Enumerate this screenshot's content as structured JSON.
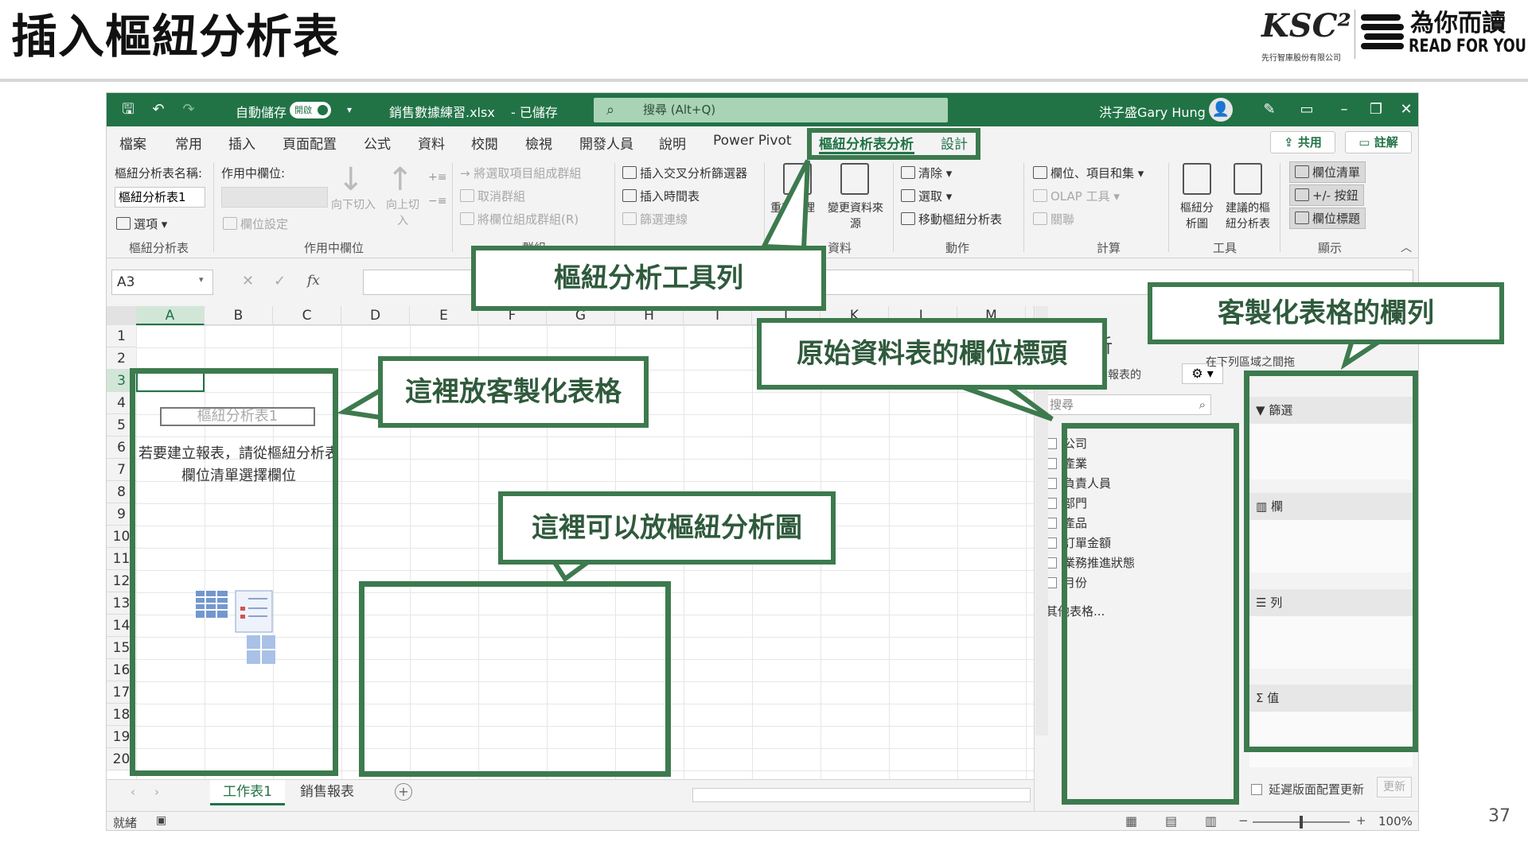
{
  "slide": {
    "title": "插入樞紐分析表",
    "page_number": "37",
    "logo_ksc": "KSC²",
    "logo_ksc_sub": "先行智庫股份有限公司",
    "logo_rfy_cn": "為你而讀",
    "logo_rfy_en": "READ FOR YOU"
  },
  "excel": {
    "titlebar": {
      "autosave_label": "自動儲存",
      "autosave_toggle": "開啟",
      "filename": "銷售數據練習.xlsx",
      "saved_state": "- 已儲存",
      "search_placeholder": "搜尋 (Alt+Q)",
      "user_name": "洪子盛Gary Hung"
    },
    "tabs": [
      "檔案",
      "常用",
      "插入",
      "頁面配置",
      "公式",
      "資料",
      "校閱",
      "檢視",
      "開發人員",
      "說明",
      "Power Pivot",
      "樞紐分析表分析",
      "設計"
    ],
    "share_button": "共用",
    "comment_button": "註解",
    "ribbon": {
      "pivot_name_label": "樞紐分析表名稱:",
      "pivot_name_value": "樞紐分析表1",
      "options_button": "選項",
      "group_pivot": "樞紐分析表",
      "active_field_label": "作用中欄位:",
      "field_settings": "欄位設定",
      "drill_down": "向下切入",
      "drill_up": "向上切入",
      "group_active_field": "作用中欄位",
      "group_selection": "將選取項目組成群組",
      "ungroup": "取消群組",
      "group_field": "將欄位組成群組(R)",
      "group_group": "群組",
      "insert_slicer": "插入交叉分析篩選器",
      "insert_timeline": "插入時間表",
      "filter_connections": "篩選連線",
      "refresh": "重新整理",
      "change_source": "變更資料來源",
      "group_data": "資料",
      "clear": "清除",
      "select": "選取",
      "move_pivot": "移動樞紐分析表",
      "group_actions": "動作",
      "fields_items_sets": "欄位、項目和集",
      "olap_tools": "OLAP 工具",
      "relationships": "關聯",
      "group_calc": "計算",
      "pivot_chart": "樞紐分析圖",
      "recommended_pivot": "建議的樞紐分析表",
      "group_tools": "工具",
      "field_list": "欄位清單",
      "buttons_toggle": "+/- 按鈕",
      "field_headers": "欄位標題",
      "group_show": "顯示"
    },
    "name_box": "A3",
    "fx_label": "fx",
    "columns": [
      "A",
      "B",
      "C",
      "D",
      "E",
      "F",
      "G",
      "H",
      "I",
      "J",
      "K",
      "L",
      "M"
    ],
    "rows": [
      "1",
      "2",
      "3",
      "4",
      "5",
      "6",
      "7",
      "8",
      "9",
      "10",
      "11",
      "12",
      "13",
      "14",
      "15",
      "16",
      "17",
      "18",
      "19",
      "20"
    ],
    "pivot_placeholder": "樞紐分析表1",
    "pivot_hint": "若要建立報表，請從樞紐分析表欄位清單選擇欄位",
    "sheets": [
      "工作表1",
      "銷售報表"
    ],
    "status": "就緒",
    "zoom": "100%",
    "pane": {
      "title_fragment": "分析",
      "choose_fields": "新增到報表的",
      "drag_hint": "在下列區域之間拖",
      "search_placeholder": "搜尋",
      "fields": [
        "公司",
        "產業",
        "負責人員",
        "部門",
        "產品",
        "訂單金額",
        "業務推進狀態",
        "月份"
      ],
      "more_tables": "其他表格...",
      "areas": {
        "filters": "篩選",
        "columns": "欄",
        "rows": "列",
        "values": "值"
      },
      "defer_update": "延遲版面配置更新",
      "update_button": "更新"
    }
  },
  "callouts": {
    "toolbar": "樞紐分析工具列",
    "custom_table": "這裡放客製化表格",
    "pivot_chart": "這裡可以放樞紐分析圖",
    "source_headers": "原始資料表的欄位標頭",
    "table_columns": "客製化表格的欄列"
  },
  "colors": {
    "excel_green": "#217346",
    "callout_green": "#3d7a4e"
  }
}
